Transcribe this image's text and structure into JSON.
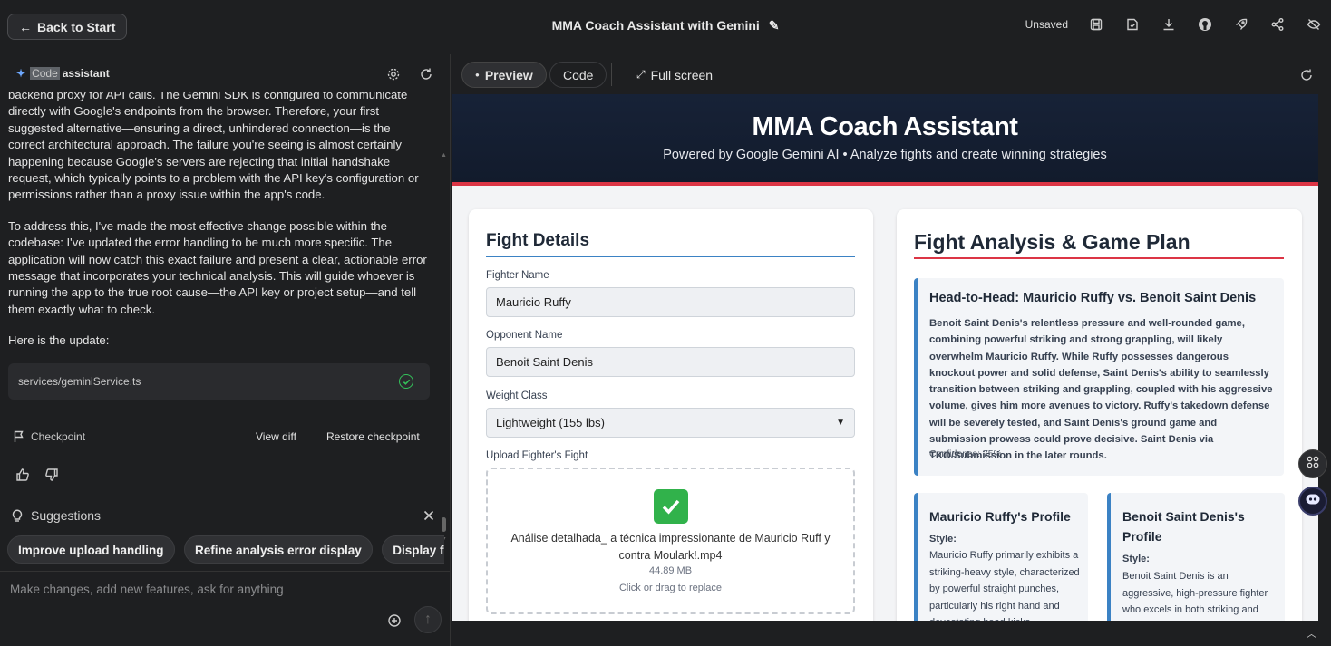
{
  "topbar": {
    "back_label": "Back to Start",
    "title": "MMA Coach Assistant with Gemini",
    "status": "Unsaved"
  },
  "assistant": {
    "header_highlight": "Code",
    "header_label": "assistant",
    "messages": [
      "backend proxy for API calls. The Gemini SDK is configured to communicate directly with Google's endpoints from the browser. Therefore, your first suggested alternative—ensuring a direct, unhindered connection—is the correct architectural approach. The failure you're seeing is almost certainly happening because Google's servers are rejecting that initial handshake request, which typically points to a problem with the API key's configuration or permissions rather than a proxy issue within the app's code.",
      "To address this, I've made the most effective change possible within the codebase: I've updated the error handling to be much more specific. The application will now catch this exact failure and present a clear, actionable error message that incorporates your technical analysis. This will guide whoever is running the app to the true root cause—the API key or project setup—and tell them exactly what to check.",
      "Here is the update:"
    ],
    "file": "services/geminiService.ts",
    "checkpoint_label": "Checkpoint",
    "view_diff": "View diff",
    "restore": "Restore checkpoint",
    "suggestions_title": "Suggestions",
    "suggestions": [
      "Improve upload handling",
      "Refine analysis error display",
      "Display file si"
    ],
    "composer_placeholder": "Make changes, add new features, ask for anything"
  },
  "preview_tabs": {
    "preview": "Preview",
    "code": "Code",
    "fullscreen": "Full screen"
  },
  "app": {
    "title": "MMA Coach Assistant",
    "subtitle": "Powered by Google Gemini AI • Analyze fights and create winning strategies",
    "fight_details": {
      "heading": "Fight Details",
      "fighter_label": "Fighter Name",
      "fighter_value": "Mauricio Ruffy",
      "opponent_label": "Opponent Name",
      "opponent_value": "Benoit Saint Denis",
      "weight_label": "Weight Class",
      "weight_value": "Lightweight (155 lbs)",
      "upload_label": "Upload Fighter's Fight",
      "upload_filename": "Análise detalhada_ a técnica impressionante de Mauricio Ruff y contra Moulark!.mp4",
      "upload_size": "44.89 MB",
      "upload_hint": "Click or drag to replace"
    },
    "analysis": {
      "heading": "Fight Analysis & Game Plan",
      "h2h_title": "Head-to-Head: Mauricio Ruffy vs. Benoit Saint Denis",
      "h2h_body": "Benoit Saint Denis's relentless pressure and well-rounded game, combining powerful striking and strong grappling, will likely overwhelm Mauricio Ruffy. While Ruffy possesses dangerous knockout power and solid defense, Saint Denis's ability to seamlessly transition between striking and grappling, coupled with his aggressive volume, gives him more avenues to victory. Ruffy's takedown defense will be severely tested, and Saint Denis's ground game and submission prowess could prove decisive. Saint Denis via TKO/Submission in the later rounds.",
      "confidence": "Confidence: 75%",
      "profile1_title": "Mauricio Ruffy's Profile",
      "profile1_style_label": "Style:",
      "profile1_style": "Mauricio Ruffy primarily exhibits a striking-heavy style, characterized by powerful straight punches, particularly his right hand and devastating head kicks",
      "profile2_title": "Benoit Saint Denis's Profile",
      "profile2_style_label": "Style:",
      "profile2_style": "Benoit Saint Denis is an aggressive, high-pressure fighter who excels in both striking and grappling"
    }
  },
  "colors": {
    "accent_blue": "#3b82c4",
    "accent_red": "#dc3545",
    "success": "#31b24b"
  }
}
